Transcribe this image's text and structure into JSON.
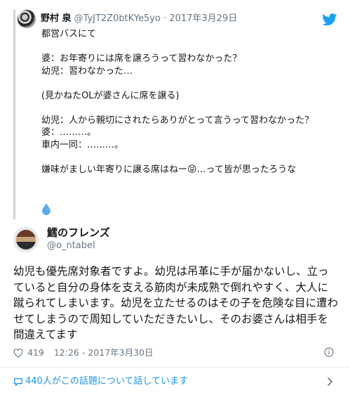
{
  "quoted_tweet": {
    "display_name": "野村 泉",
    "handle": "@TyJT2Z0btKYe5yo",
    "separator": " · ",
    "date": "2017年3月29日",
    "text": "都営バスにて\n\n婆：お年寄りには席を譲ろうって習わなかった？\n幼児：習わなかった…\n\n(見かねたOLが婆さんに席を譲る)\n\n幼児：人から親切にされたらありがとって言うって習わなかった？\n婆：………。\n車内一同：………。\n\n嫌味がましい年寄りに譲る席はねー😝…って皆が思ったろうな",
    "trailing_emoji": "💧"
  },
  "main_tweet": {
    "display_name": "鱈のフレンズ",
    "handle": "@o_ntabel",
    "text": "幼児も優先席対象者ですよ。幼児は吊革に手が届かないし、立っていると自分の身体を支える筋肉が未成熟で倒れやすく、大人に蹴られてしまいます。幼児を立たせるのはその子を危険な目に遭わせてしまうので周知していただきたいし、そのお婆さんは相手を間違えてます",
    "like_count": "419",
    "timestamp": "12:26 - 2017年3月30日"
  },
  "footer": {
    "talking_label": "440人がこの話題について話しています"
  },
  "icons": {
    "brand": "twitter-bird-icon",
    "like": "heart-icon",
    "info": "info-icon",
    "talk": "speech-bubble-icon",
    "more": "chevron-right-icon"
  },
  "colors": {
    "accent": "#1b95e0",
    "muted": "#657786",
    "text": "#14171a",
    "quote_bar": "#ccd6dd",
    "divider": "#e6ecf0"
  }
}
